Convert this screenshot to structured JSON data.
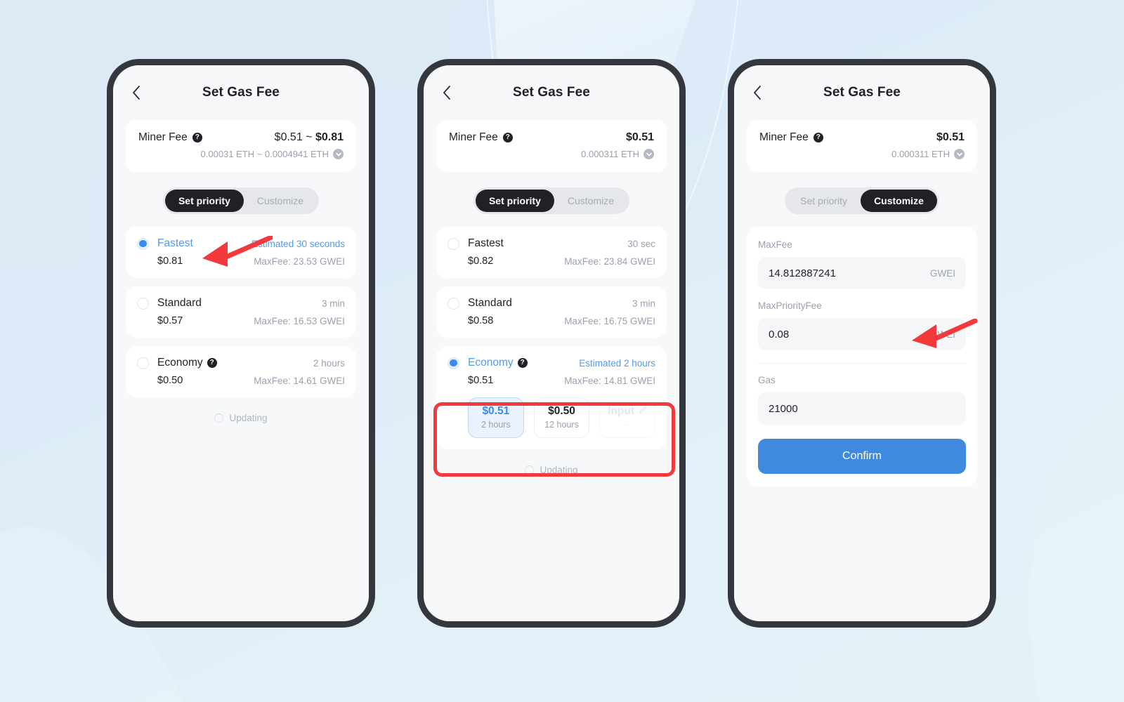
{
  "theme": {
    "accent_blue": "#3b8bee",
    "confirm_blue": "#3f8ade",
    "dark": "#1f2127",
    "muted": "#9aa1ae",
    "annotation_red": "#f4393c",
    "background": "#dceaf6"
  },
  "phones": [
    {
      "id": "phone-1",
      "nav": {
        "back_icon": "chevron-left-icon",
        "title": "Set Gas Fee"
      },
      "miner_fee": {
        "label": "Miner Fee",
        "help_icon": "question-mark-icon",
        "amount_prefix": "$0.51 ~ ",
        "amount_bold": "$0.81",
        "sub": "0.00031 ETH ~ 0.0004941 ETH",
        "expand_icon": "chevron-down-circle-icon"
      },
      "segmented": {
        "options": [
          "Set priority",
          "Customize"
        ],
        "active": "Set priority"
      },
      "options": [
        {
          "name": "Fastest",
          "eta": "Estimated 30 seconds",
          "price": "$0.81",
          "maxfee": "MaxFee: 23.53 GWEI",
          "selected": true,
          "has_help": false
        },
        {
          "name": "Standard",
          "eta": "3 min",
          "price": "$0.57",
          "maxfee": "MaxFee: 16.53 GWEI",
          "selected": false,
          "has_help": false
        },
        {
          "name": "Economy",
          "eta": "2 hours",
          "price": "$0.50",
          "maxfee": "MaxFee: 14.61 GWEI",
          "selected": false,
          "has_help": true
        }
      ],
      "updating": {
        "label": "Updating",
        "icon": "spinner-icon"
      }
    },
    {
      "id": "phone-2",
      "nav": {
        "back_icon": "chevron-left-icon",
        "title": "Set Gas Fee"
      },
      "miner_fee": {
        "label": "Miner Fee",
        "help_icon": "question-mark-icon",
        "amount_prefix": "",
        "amount_bold": "$0.51",
        "sub": "0.000311 ETH",
        "expand_icon": "chevron-down-circle-icon"
      },
      "segmented": {
        "options": [
          "Set priority",
          "Customize"
        ],
        "active": "Set priority"
      },
      "options": [
        {
          "name": "Fastest",
          "eta": "30 sec",
          "price": "$0.82",
          "maxfee": "MaxFee: 23.84 GWEI",
          "selected": false,
          "has_help": false
        },
        {
          "name": "Standard",
          "eta": "3 min",
          "price": "$0.58",
          "maxfee": "MaxFee: 16.75 GWEI",
          "selected": false,
          "has_help": false
        },
        {
          "name": "Economy",
          "eta": "Estimated 2 hours",
          "price": "$0.51",
          "maxfee": "MaxFee: 14.81 GWEI",
          "selected": true,
          "has_help": true
        }
      ],
      "chips": [
        {
          "top": "$0.51",
          "bottom": "2 hours",
          "state": "selected"
        },
        {
          "top": "$0.50",
          "bottom": "12 hours",
          "state": "normal"
        },
        {
          "top": "Input",
          "bottom": "-",
          "state": "ghost",
          "icon": "pencil-edit-icon"
        }
      ],
      "updating": {
        "label": "Updating",
        "icon": "spinner-icon"
      }
    },
    {
      "id": "phone-3",
      "nav": {
        "back_icon": "chevron-left-icon",
        "title": "Set Gas Fee"
      },
      "miner_fee": {
        "label": "Miner Fee",
        "help_icon": "question-mark-icon",
        "amount_prefix": "",
        "amount_bold": "$0.51",
        "sub": "0.000311 ETH",
        "expand_icon": "chevron-down-circle-icon"
      },
      "segmented": {
        "options": [
          "Set priority",
          "Customize"
        ],
        "active": "Customize"
      },
      "fields": [
        {
          "label": "MaxFee",
          "value": "14.812887241",
          "unit": "GWEI"
        },
        {
          "label": "MaxPriorityFee",
          "value": "0.08",
          "unit": "GWEI"
        },
        {
          "label": "Gas",
          "value": "21000",
          "unit": ""
        }
      ],
      "confirm_label": "Confirm"
    }
  ],
  "annotations": {
    "arrow_1": {
      "type": "arrow",
      "target": "fastest-option-row",
      "color": "#f4393c"
    },
    "red_box": {
      "type": "box",
      "target": "economy-chips-group",
      "color": "#f4393c"
    },
    "arrow_3": {
      "type": "arrow",
      "target": "maxpriorityfee-field",
      "color": "#f4393c"
    }
  }
}
